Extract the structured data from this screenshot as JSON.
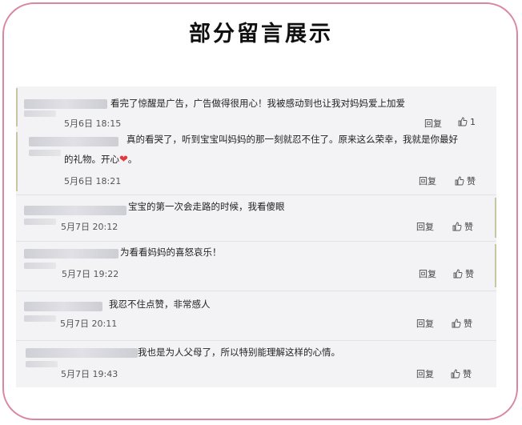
{
  "title": "部分留言展示",
  "comments": [
    {
      "text": "看完了惊醒是广告，广告做得很用心！我被感动到也让我对妈妈爱上加爱",
      "date": "5月6日 18:15",
      "reply": "回复",
      "like": "1"
    },
    {
      "text_line1": "真的看哭了，听到宝宝叫妈妈的那一刻就忍不住了。原来这么荣幸，我就是你最好",
      "text_line2": "的礼物。开心",
      "heart": "❤",
      "date": "5月6日 18:21",
      "reply": "回复",
      "like": "赞"
    },
    {
      "text": "宝宝的第一次会走路的时候，我看傻眼",
      "date": "5月7日 20:12",
      "reply": "回复",
      "like": "赞"
    },
    {
      "text": "为看看妈妈的喜怒哀乐！",
      "date": "5月7日 19:22",
      "reply": "回复",
      "like": "赞"
    },
    {
      "text": "我忍不住点赞，非常感人",
      "date": "5月7日 20:11",
      "reply": "回复",
      "like": "赞"
    },
    {
      "text": "我也是为人父母了，所以特别能理解这样的心情。",
      "date": "5月7日 19:43",
      "reply": "回复",
      "like": "赞"
    }
  ],
  "colors": {
    "frame_border": "#d9869f",
    "panel_bg": "#f3f3f5",
    "heart": "#e23a3a"
  }
}
